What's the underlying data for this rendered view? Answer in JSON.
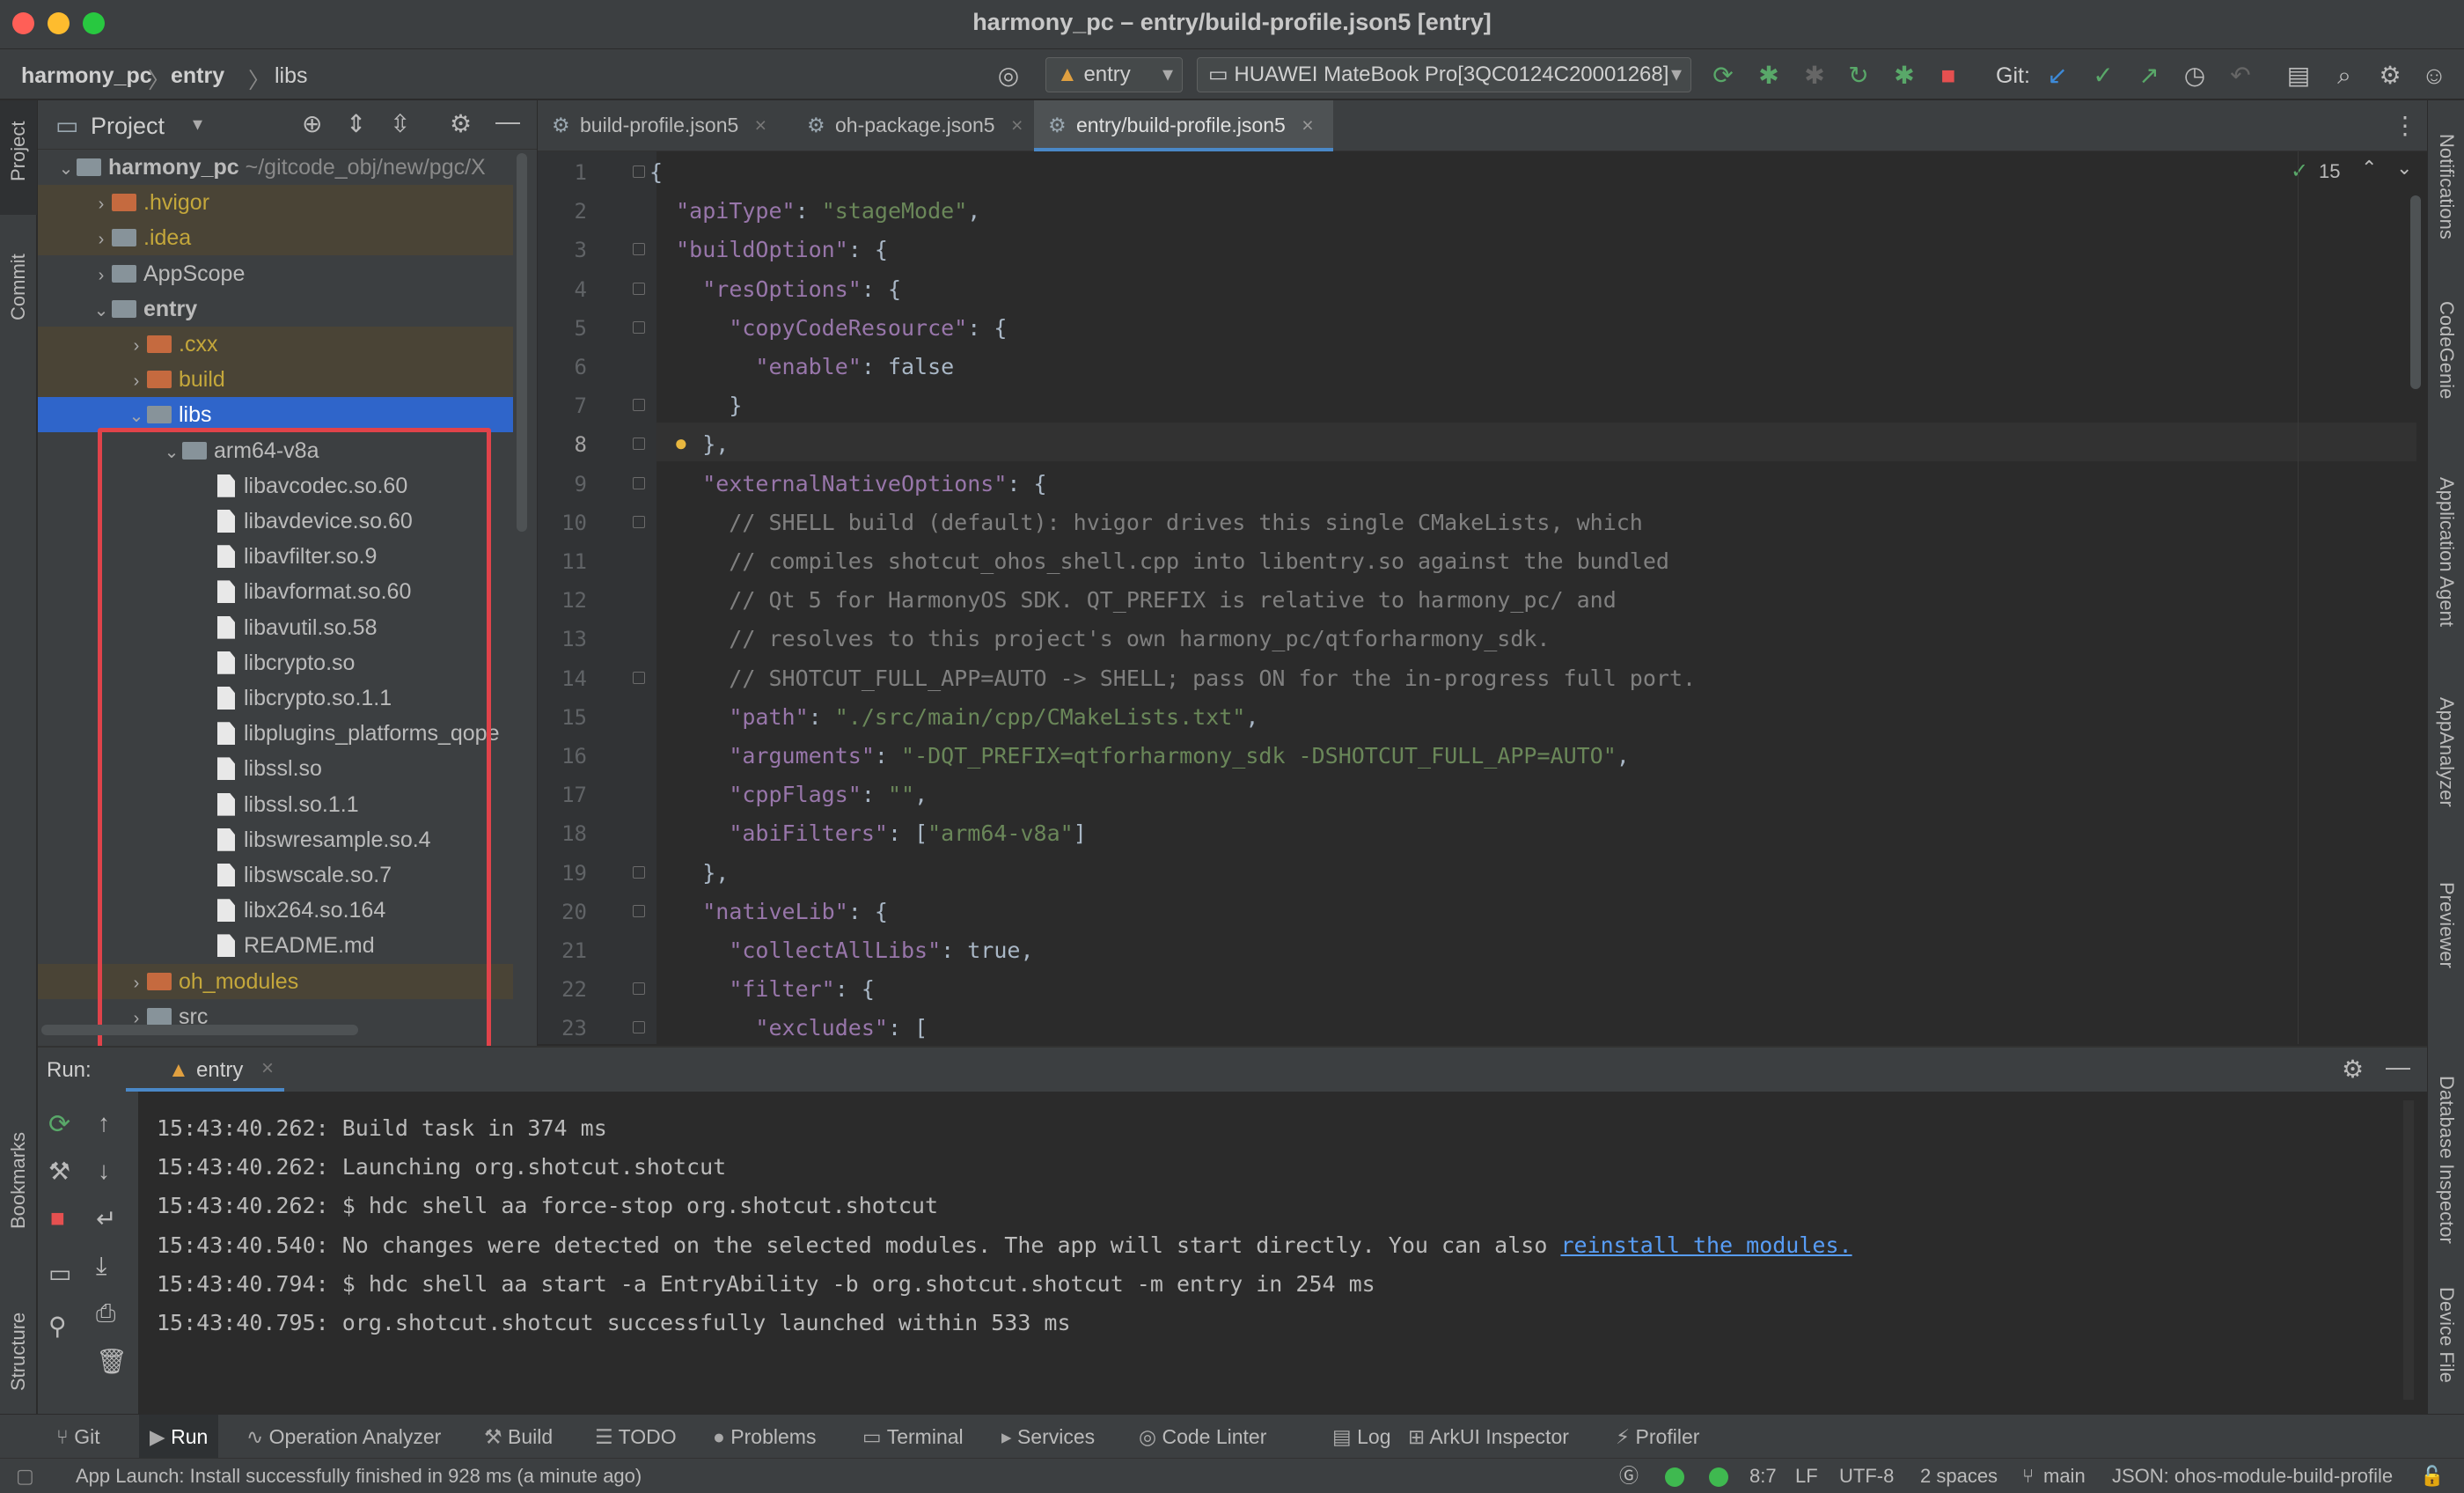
{
  "window": {
    "title": "harmony_pc – entry/build-profile.json5 [entry]"
  },
  "nav": {
    "breadcrumb": [
      "harmony_pc",
      "entry",
      "libs"
    ],
    "module_select": "entry",
    "device_select": "HUAWEI MateBook Pro[3QC0124C20001268]",
    "git_label": "Git:"
  },
  "left_strip": {
    "project": "Project",
    "commit": "Commit",
    "bookmarks": "Bookmarks",
    "structure": "Structure"
  },
  "right_strip": [
    "Notifications",
    "CodeGenie",
    "Application Agent",
    "AppAnalyzer",
    "Previewer",
    "Database Inspector",
    "Device File"
  ],
  "project_panel": {
    "title": "Project",
    "tree": [
      {
        "label": "harmony_pc",
        "suffix": "~/gitcode_obj/new/pgc/X",
        "indent": 0,
        "type": "folder",
        "expanded": true,
        "bold": true
      },
      {
        "label": ".hvigor",
        "indent": 1,
        "type": "folder-or",
        "expanded": false,
        "excluded": true
      },
      {
        "label": ".idea",
        "indent": 1,
        "type": "folder",
        "expanded": false,
        "excluded": true
      },
      {
        "label": "AppScope",
        "indent": 1,
        "type": "folder",
        "expanded": false
      },
      {
        "label": "entry",
        "indent": 1,
        "type": "folder",
        "expanded": true,
        "bold": true
      },
      {
        "label": ".cxx",
        "indent": 2,
        "type": "folder-or",
        "expanded": false,
        "excluded": true
      },
      {
        "label": "build",
        "indent": 2,
        "type": "folder-or",
        "expanded": false,
        "excluded": true
      },
      {
        "label": "libs",
        "indent": 2,
        "type": "folder",
        "expanded": true,
        "selected": true
      },
      {
        "label": "arm64-v8a",
        "indent": 3,
        "type": "folder",
        "expanded": true
      },
      {
        "label": "libavcodec.so.60",
        "indent": 4,
        "type": "file"
      },
      {
        "label": "libavdevice.so.60",
        "indent": 4,
        "type": "file"
      },
      {
        "label": "libavfilter.so.9",
        "indent": 4,
        "type": "file"
      },
      {
        "label": "libavformat.so.60",
        "indent": 4,
        "type": "file"
      },
      {
        "label": "libavutil.so.58",
        "indent": 4,
        "type": "file"
      },
      {
        "label": "libcrypto.so",
        "indent": 4,
        "type": "file"
      },
      {
        "label": "libcrypto.so.1.1",
        "indent": 4,
        "type": "file"
      },
      {
        "label": "libplugins_platforms_qope",
        "indent": 4,
        "type": "file"
      },
      {
        "label": "libssl.so",
        "indent": 4,
        "type": "file"
      },
      {
        "label": "libssl.so.1.1",
        "indent": 4,
        "type": "file"
      },
      {
        "label": "libswresample.so.4",
        "indent": 4,
        "type": "file"
      },
      {
        "label": "libswscale.so.7",
        "indent": 4,
        "type": "file"
      },
      {
        "label": "libx264.so.164",
        "indent": 4,
        "type": "file"
      },
      {
        "label": "README.md",
        "indent": 4,
        "type": "file"
      },
      {
        "label": "oh_modules",
        "indent": 2,
        "type": "folder-or",
        "expanded": false,
        "excluded": true
      },
      {
        "label": "src",
        "indent": 2,
        "type": "folder",
        "expanded": false
      }
    ]
  },
  "editor": {
    "tabs": [
      {
        "label": "build-profile.json5",
        "active": false
      },
      {
        "label": "oh-package.json5",
        "active": false
      },
      {
        "label": "entry/build-profile.json5",
        "active": true
      }
    ],
    "inspection_count": "15",
    "lines": [
      {
        "n": "1",
        "t": "{"
      },
      {
        "n": "2",
        "t": "  \"apiType\": \"stageMode\","
      },
      {
        "n": "3",
        "t": "  \"buildOption\": {"
      },
      {
        "n": "4",
        "t": "    \"resOptions\": {"
      },
      {
        "n": "5",
        "t": "      \"copyCodeResource\": {"
      },
      {
        "n": "6",
        "t": "        \"enable\": false"
      },
      {
        "n": "7",
        "t": "      }"
      },
      {
        "n": "8",
        "t": "    },"
      },
      {
        "n": "9",
        "t": "    \"externalNativeOptions\": {"
      },
      {
        "n": "10",
        "t": "      // SHELL build (default): hvigor drives this single CMakeLists, which"
      },
      {
        "n": "11",
        "t": "      // compiles shotcut_ohos_shell.cpp into libentry.so against the bundled"
      },
      {
        "n": "12",
        "t": "      // Qt 5 for HarmonyOS SDK. QT_PREFIX is relative to harmony_pc/ and"
      },
      {
        "n": "13",
        "t": "      // resolves to this project's own harmony_pc/qtforharmony_sdk."
      },
      {
        "n": "14",
        "t": "      // SHOTCUT_FULL_APP=AUTO -> SHELL; pass ON for the in-progress full port."
      },
      {
        "n": "15",
        "t": "      \"path\": \"./src/main/cpp/CMakeLists.txt\","
      },
      {
        "n": "16",
        "t": "      \"arguments\": \"-DQT_PREFIX=qtforharmony_sdk -DSHOTCUT_FULL_APP=AUTO\","
      },
      {
        "n": "17",
        "t": "      \"cppFlags\": \"\","
      },
      {
        "n": "18",
        "t": "      \"abiFilters\": [\"arm64-v8a\"]"
      },
      {
        "n": "19",
        "t": "    },"
      },
      {
        "n": "20",
        "t": "    \"nativeLib\": {"
      },
      {
        "n": "21",
        "t": "      \"collectAllLibs\": true,"
      },
      {
        "n": "22",
        "t": "      \"filter\": {"
      },
      {
        "n": "23",
        "t": "        \"excludes\": ["
      }
    ]
  },
  "run": {
    "label": "Run:",
    "tab": "entry",
    "log": [
      "15:43:40.262: Build task in 374 ms",
      "15:43:40.262: Launching org.shotcut.shotcut",
      "15:43:40.262: $ hdc shell aa force-stop org.shotcut.shotcut",
      "15:43:40.540: No changes were detected on the selected modules. The app will start directly. You can also ",
      "15:43:40.794: $ hdc shell aa start -a EntryAbility -b org.shotcut.shotcut -m entry in 254 ms",
      "15:43:40.795: org.shotcut.shotcut successfully launched within 533 ms"
    ],
    "link": "reinstall the modules."
  },
  "bottom_tools": [
    "Git",
    "Run",
    "Operation Analyzer",
    "Build",
    "TODO",
    "Problems",
    "Terminal",
    "Services",
    "Code Linter",
    "Log",
    "ArkUI Inspector",
    "Profiler"
  ],
  "status": {
    "message": "App Launch: Install successfully finished in 928 ms (a minute ago)",
    "position": "8:7",
    "line_sep": "LF",
    "encoding": "UTF-8",
    "indent": "2 spaces",
    "branch": "main",
    "schema": "JSON: ohos-module-build-profile"
  },
  "colors": {
    "accent": "#2f65ca",
    "highlight_box": "#e0434a",
    "link": "#589df6"
  }
}
